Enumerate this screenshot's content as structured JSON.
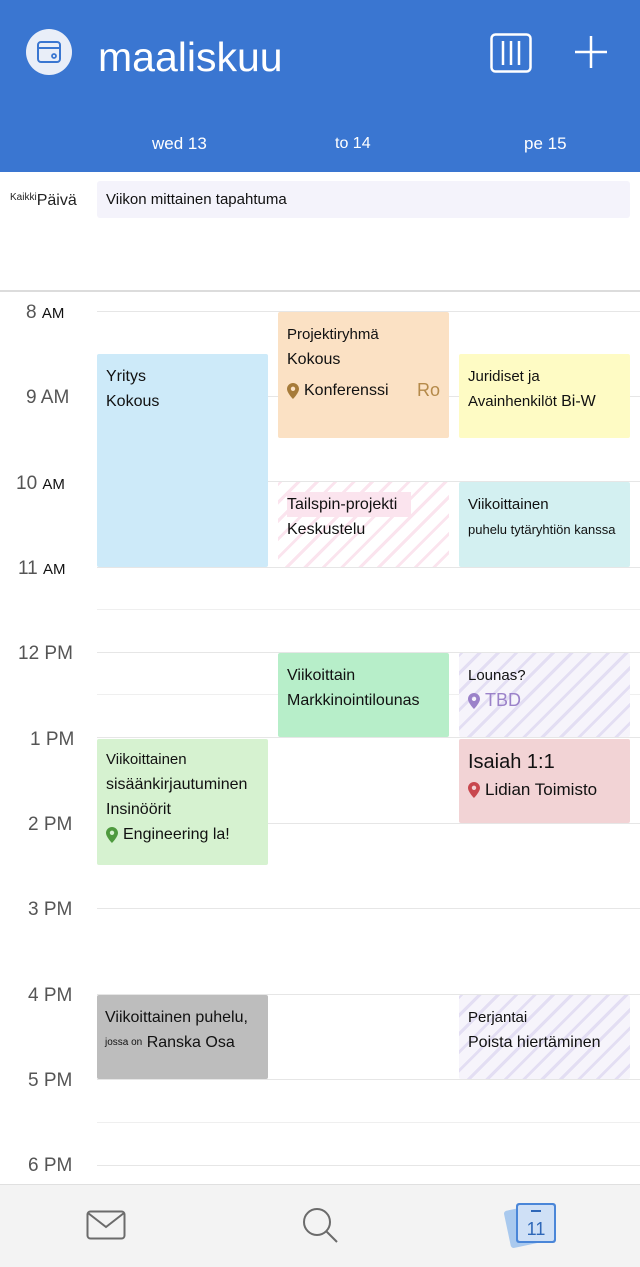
{
  "header": {
    "month_title": "maaliskuu",
    "days": [
      "wed 13",
      "to 14",
      "pe 15"
    ]
  },
  "all_day": {
    "label_small": "Kaikki",
    "label": "Päivä",
    "event": "Viikon mittainen tapahtuma"
  },
  "hours": [
    {
      "num": "8",
      "suffix": "AM"
    },
    {
      "num": "9 AM",
      "suffix": ""
    },
    {
      "num": "10",
      "suffix": "AM"
    },
    {
      "num": "11",
      "suffix": "AM"
    },
    {
      "num": "12 PM",
      "suffix": ""
    },
    {
      "num": "1 PM",
      "suffix": ""
    },
    {
      "num": "2 PM",
      "suffix": ""
    },
    {
      "num": "3 PM",
      "suffix": ""
    },
    {
      "num": "4 PM",
      "suffix": ""
    },
    {
      "num": "5 PM",
      "suffix": ""
    },
    {
      "num": "6 PM",
      "suffix": ""
    }
  ],
  "events": {
    "yritys": {
      "line1": "Yritys",
      "line2": "Kokous"
    },
    "weekly_signin": {
      "line1": "Viikoittainen",
      "line2": "sisäänkirjautuminen",
      "line3": "Insinöörit",
      "location": "Engineering la!"
    },
    "weekly_call_france": {
      "line1": "Viikoittainen puhelu,",
      "line2_small": "jossa on",
      "line2": "Ranska  Osa"
    },
    "project_team": {
      "line1": "Projektiryhmä",
      "line2": "Kokous",
      "location": "Konferenssi",
      "extra": "Ro"
    },
    "tailspin": {
      "line1": "Tailspin-projekti",
      "line2": "Keskustelu"
    },
    "marketing_lunch": {
      "line1": "Viikoittain",
      "line2": "Markkinointilounas"
    },
    "legal": {
      "line1": "Juridiset ja",
      "line2": "Avainhenkilöt",
      "extra": "Bi-W"
    },
    "subsidiary_call": {
      "line1": "Viikoittainen",
      "line2": "puhelu tytäryhtiön kanssa"
    },
    "lunch": {
      "line1": "Lounas?",
      "location": "TBD"
    },
    "isaiah": {
      "line1": "Isaiah 1:1",
      "location": "Lidian Toimisto"
    },
    "friday_rotate": {
      "line1": "Perjantai",
      "line2": "Poista hiertäminen"
    }
  },
  "colors": {
    "header": "#3a76d1",
    "blue_event": "#cdeaf9",
    "green_event": "#d6f2d0",
    "gray_event": "#bdbdbd",
    "orange_event": "#fbe1c4",
    "mint_event": "#b7eec9",
    "yellow_event": "#fefbc4",
    "teal_event": "#d3f0f1",
    "red_event": "#f2d3d5"
  },
  "tabs": [
    "mail-icon",
    "search-icon",
    "calendar-icon"
  ],
  "calendar_tab_date": "11"
}
